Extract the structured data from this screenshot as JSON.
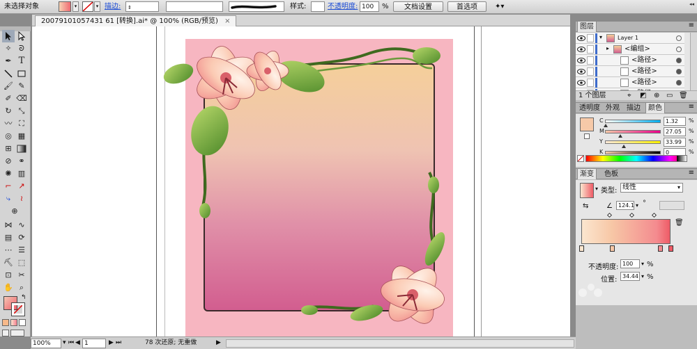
{
  "control_bar": {
    "selection_status": "未选择对象",
    "stroke_label": "描边:",
    "style_label": "样式:",
    "opacity_label": "不透明度:",
    "opacity_value": "100",
    "opacity_unit": "%",
    "doc_setup_button": "文档设置",
    "preferences_button": "首选项"
  },
  "document": {
    "tab_title": "20079101057431 61 [转换].ai* @ 100% (RGB/预览)",
    "tab_close": "×"
  },
  "status_bar": {
    "zoom": "100%",
    "artboard": "1",
    "status_text": "78 次还原; 无重做"
  },
  "layers_panel": {
    "title": "图层",
    "rows": [
      {
        "name": "Layer 1",
        "indent": 0
      },
      {
        "name": "<编组>",
        "indent": 1
      },
      {
        "name": "<路径>",
        "indent": 2
      },
      {
        "name": "<路径>",
        "indent": 2
      },
      {
        "name": "<路径>",
        "indent": 2
      },
      {
        "name": "<路径>",
        "indent": 2
      }
    ],
    "footer_count": "1 个图层"
  },
  "appearance_panel": {
    "tabs": [
      "透明度",
      "外观",
      "描边",
      "颜色"
    ],
    "active_tab": "颜色",
    "channels": [
      {
        "label": "C",
        "value": "1.32",
        "fraction": 0.013
      },
      {
        "label": "M",
        "value": "27.05",
        "fraction": 0.27
      },
      {
        "label": "Y",
        "value": "33.99",
        "fraction": 0.34
      },
      {
        "label": "K",
        "value": "0",
        "fraction": 0.0
      }
    ],
    "pct": "%"
  },
  "gradient_panel": {
    "tabs": [
      "渐变",
      "色板"
    ],
    "active_tab": "渐变",
    "type_label": "类型:",
    "type_value": "线性",
    "angle_value": "124.1",
    "angle_unit": "°",
    "opacity_label": "不透明度:",
    "opacity_value": "100",
    "location_label": "位置:",
    "location_value": "34.44",
    "pct": "%",
    "colors": [
      "#fbe6cf",
      "#f7c7a6",
      "#f48b8f",
      "#ee5b66"
    ]
  },
  "colors": {
    "frame_pink": "#f7b6c1",
    "bg_top": "#f5d09a",
    "bg_bottom": "#d55f92",
    "accent_blue": "#1a4bd6"
  }
}
